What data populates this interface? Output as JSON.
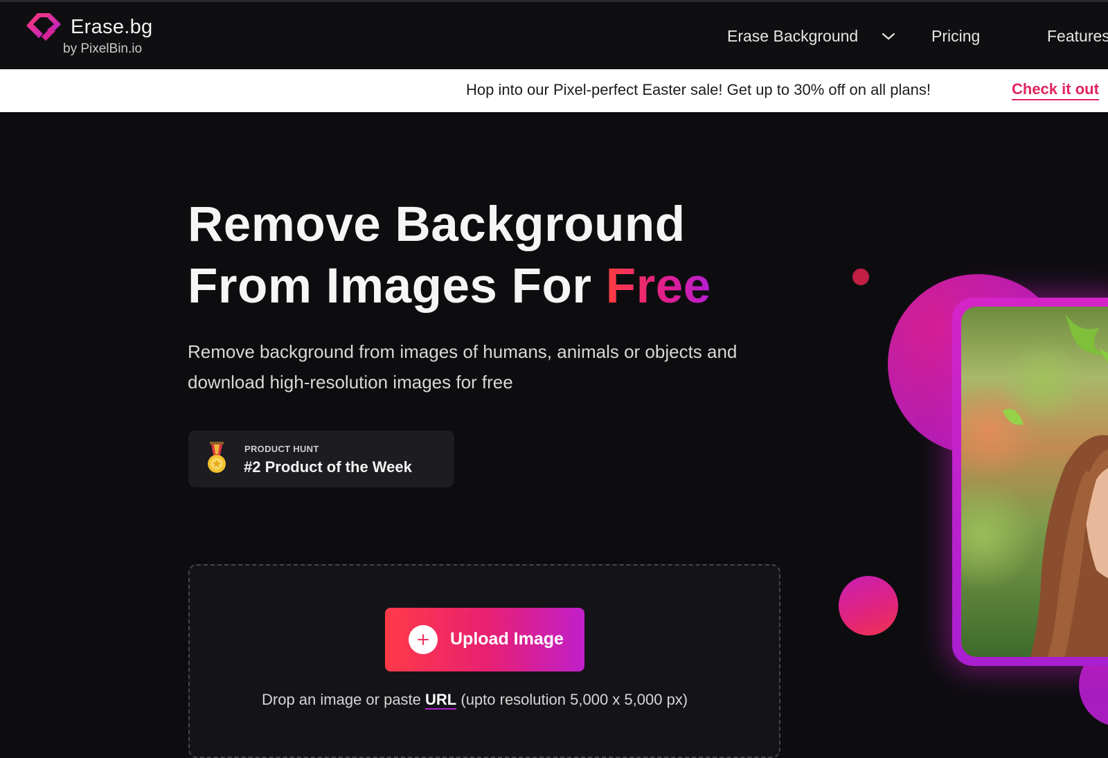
{
  "brand": {
    "name": "Erase.bg",
    "byline": "by PixelBin.io",
    "colors": {
      "accent_red": "#ff3a48",
      "accent_pink": "#e0245e",
      "accent_purple": "#b51fd6"
    }
  },
  "nav": {
    "items": [
      {
        "label": "Erase Background",
        "icon": "chevron-down-icon"
      },
      {
        "label": "Pricing"
      },
      {
        "label": "Features"
      }
    ]
  },
  "promo": {
    "text": "Hop into our Pixel-perfect Easter sale! Get up to 30% off on all plans!",
    "link_label": "Check it out"
  },
  "hero": {
    "headline_line1": "Remove Background",
    "headline_line2_prefix": "From Images For ",
    "headline_highlight": "Free",
    "description": "Remove background from images of humans, animals or objects and download high-resolution images for free"
  },
  "badge": {
    "icon": "medal-icon",
    "source": "PRODUCT HUNT",
    "title": "#2 Product of the Week"
  },
  "upload": {
    "button_label": "Upload Image",
    "icon": "plus-icon",
    "hint_prefix": "Drop an image or paste ",
    "hint_link": "URL",
    "hint_suffix": " (upto resolution 5,000 x 5,000 px)"
  }
}
